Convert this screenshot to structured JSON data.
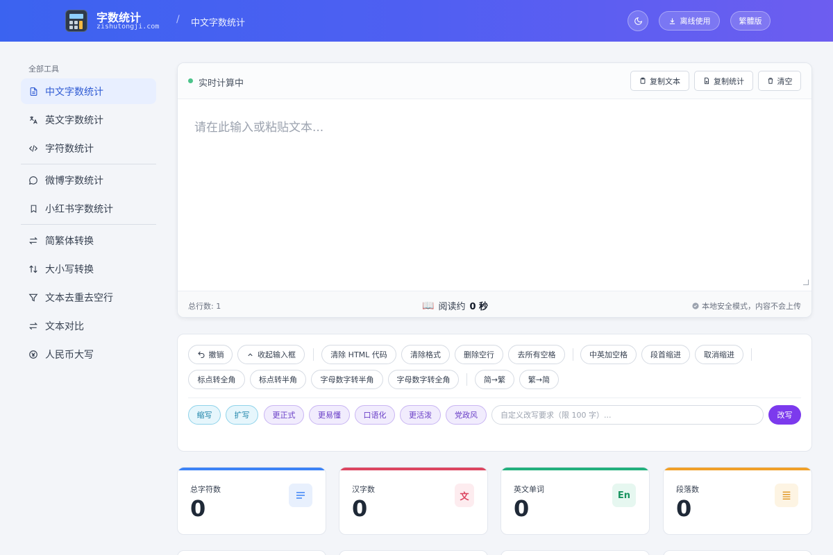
{
  "header": {
    "title": "字数统计",
    "subtitle": "zishutongji.com",
    "breadcrumb": "中文字数统计",
    "offline_label": "离线使用",
    "trad_label": "繁體版"
  },
  "sidebar": {
    "section_label": "全部工具",
    "items": [
      {
        "label": "中文字数统计",
        "icon": "document-icon"
      },
      {
        "label": "英文字数统计",
        "icon": "translate-icon"
      },
      {
        "label": "字符数统计",
        "icon": "code-icon"
      },
      {
        "label": "微博字数统计",
        "icon": "chat-icon"
      },
      {
        "label": "小红书字数统计",
        "icon": "bookmark-icon"
      },
      {
        "label": "简繁体转换",
        "icon": "swap-icon"
      },
      {
        "label": "大小写转换",
        "icon": "case-icon"
      },
      {
        "label": "文本去重去空行",
        "icon": "filter-icon"
      },
      {
        "label": "文本对比",
        "icon": "compare-icon"
      },
      {
        "label": "人民币大写",
        "icon": "yuan-icon"
      }
    ]
  },
  "editor": {
    "status": "实时计算中",
    "copy_text": "复制文本",
    "copy_stats": "复制统计",
    "clear": "清空",
    "placeholder": "请在此输入或粘贴文本...",
    "value": "",
    "line_count_label": "总行数: 1",
    "read_prefix": "阅读约",
    "read_value": "0 秒",
    "safe_note": "本地安全模式，内容不会上传"
  },
  "tools": {
    "row1": [
      "撤销",
      "收起输入框",
      "清除 HTML 代码",
      "清除格式",
      "删除空行",
      "去所有空格",
      "中英加空格",
      "段首缩进",
      "取消缩进"
    ],
    "row2": [
      "标点转全角",
      "标点转半角",
      "字母数字转半角",
      "字母数字转全角",
      "简→繁",
      "繁→简"
    ],
    "ai": [
      "缩写",
      "扩写",
      "更正式",
      "更易懂",
      "口语化",
      "更活泼",
      "党政风"
    ],
    "custom_placeholder": "自定义改写要求（限 100 字）...",
    "rewrite": "改写"
  },
  "stats": [
    {
      "label": "总字符数",
      "value": "0",
      "icon": "lines-icon",
      "glyph": "",
      "color": "#3b82f6"
    },
    {
      "label": "汉字数",
      "value": "0",
      "icon": "hanzi-icon",
      "glyph": "文",
      "color": "#dc4560"
    },
    {
      "label": "英文单词",
      "value": "0",
      "icon": "english-icon",
      "glyph": "En",
      "color": "#22b07d"
    },
    {
      "label": "段落数",
      "value": "0",
      "icon": "paragraph-icon",
      "glyph": "",
      "color": "#f0a028"
    }
  ]
}
